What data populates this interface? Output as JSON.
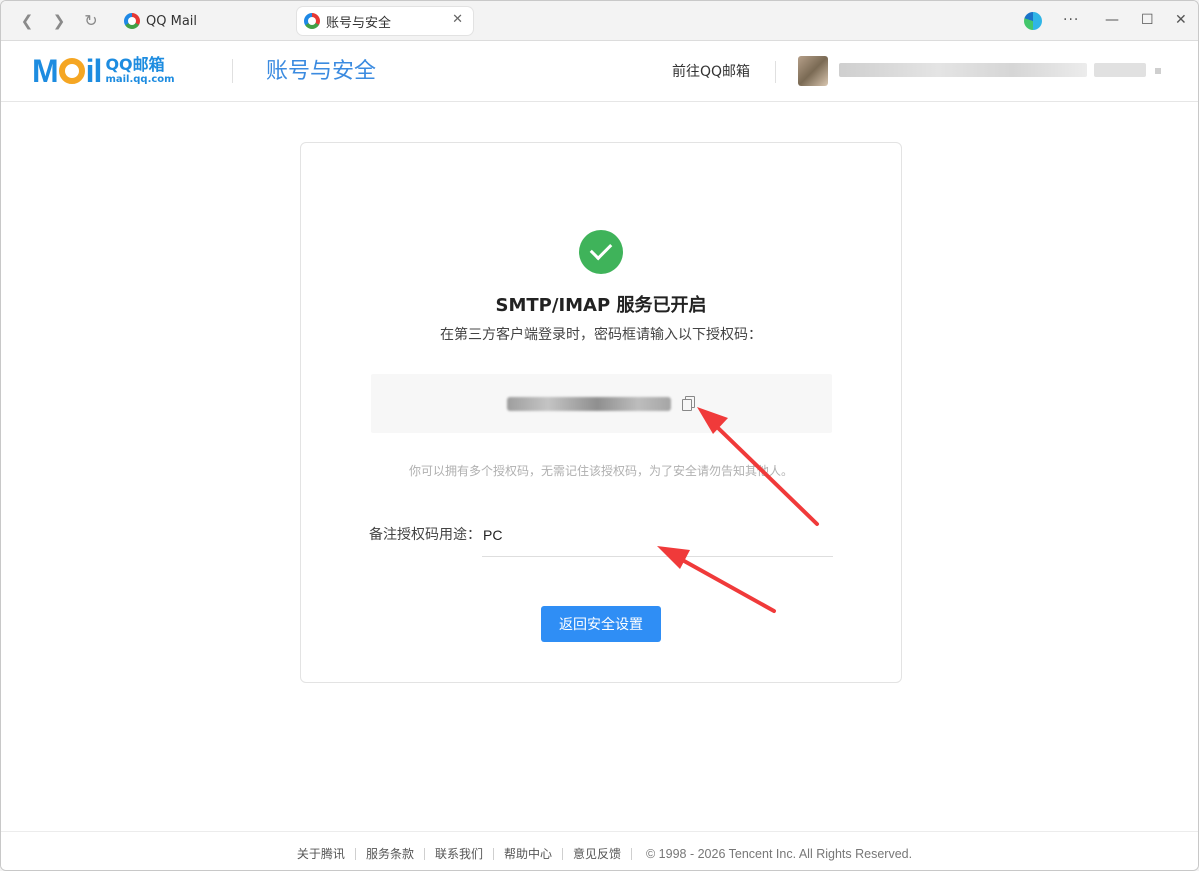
{
  "browser": {
    "tabs": [
      {
        "title": "QQ Mail",
        "active": false
      },
      {
        "title": "账号与安全",
        "active": true
      }
    ],
    "close_symbol": "✕",
    "controls": {
      "more": "···",
      "minimize": "—",
      "maximize": "☐",
      "close": "✕"
    }
  },
  "header": {
    "logo_mail": "M",
    "logo_mail_suffix": "il",
    "logo_qq": "QQ邮箱",
    "logo_domain": "mail.qq.com",
    "page_title": "账号与安全",
    "goto_link": "前往QQ邮箱"
  },
  "card": {
    "title": "SMTP/IMAP 服务已开启",
    "subtitle": "在第三方客户端登录时，密码框请输入以下授权码：",
    "hint": "你可以拥有多个授权码，无需记住该授权码，为了安全请勿告知其他人。",
    "note_label": "备注授权码用途：",
    "note_value": "PC",
    "back_button": "返回安全设置"
  },
  "footer": {
    "links": [
      "关于腾讯",
      "服务条款",
      "联系我们",
      "帮助中心",
      "意见反馈"
    ],
    "copyright": "© 1998 - 2026 Tencent Inc. All Rights Reserved."
  },
  "colors": {
    "accent": "#2f8ef5",
    "success": "#3fb35a",
    "annotation_arrow": "#f03a3a"
  }
}
